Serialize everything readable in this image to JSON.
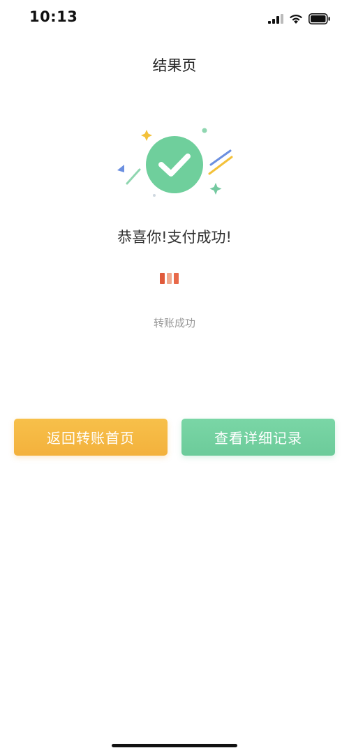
{
  "status_bar": {
    "time": "10:13",
    "icons": [
      "signal-icon",
      "wifi-icon",
      "battery-icon"
    ]
  },
  "header": {
    "title": "结果页"
  },
  "illustration": {
    "icon": "check-icon",
    "colors": {
      "circle": "#6fcf9c",
      "check": "#ffffff",
      "star_yellow": "#f3c13a",
      "star_green": "#74c9a0",
      "line_blue": "#6b8fe0",
      "line_yellow": "#f3c13a",
      "line_green": "#8fd6b0"
    }
  },
  "result": {
    "title": "恭喜你!支付成功!",
    "status": "转账成功",
    "amount_redacted_colors": [
      "#e05a3b",
      "#f0a98e",
      "#e8694a"
    ]
  },
  "actions": {
    "back_label": "返回转账首页",
    "detail_label": "查看详细记录"
  },
  "colors": {
    "primary_yellow": "#f3b13c",
    "primary_green": "#6ccb9a",
    "text_secondary": "#999999"
  }
}
